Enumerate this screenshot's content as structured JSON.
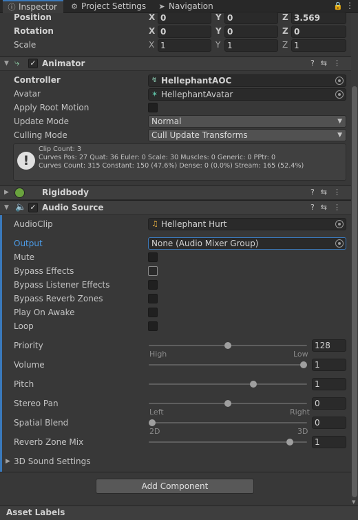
{
  "tabs": [
    {
      "label": "Inspector",
      "icon": "info-icon"
    },
    {
      "label": "Project Settings",
      "icon": "gear-icon"
    },
    {
      "label": "Navigation",
      "icon": "navigation-icon"
    }
  ],
  "transform": {
    "position": {
      "label": "Position",
      "x": "0",
      "y": "0",
      "z": "3.569"
    },
    "rotation": {
      "label": "Rotation",
      "x": "0",
      "y": "0",
      "z": "0"
    },
    "scale": {
      "label": "Scale",
      "x": "1",
      "y": "1",
      "z": "1"
    },
    "axes": {
      "x": "X",
      "y": "Y",
      "z": "Z"
    }
  },
  "animator": {
    "title": "Animator",
    "enabled": true,
    "controller": {
      "label": "Controller",
      "value": "HellephantAOC"
    },
    "avatar": {
      "label": "Avatar",
      "value": "HellephantAvatar"
    },
    "apply_root_motion": {
      "label": "Apply Root Motion",
      "checked": false
    },
    "update_mode": {
      "label": "Update Mode",
      "value": "Normal"
    },
    "culling_mode": {
      "label": "Culling Mode",
      "value": "Cull Update Transforms"
    },
    "info": {
      "line1": "Clip Count: 3",
      "line2": "Curves Pos: 27 Quat: 36 Euler: 0 Scale: 30 Muscles: 0 Generic: 0 PPtr: 0",
      "line3": "Curves Count: 315 Constant: 150 (47.6%) Dense: 0 (0.0%) Stream: 165 (52.4%)"
    }
  },
  "rigidbody": {
    "title": "Rigidbody"
  },
  "audio_source": {
    "title": "Audio Source",
    "enabled": true,
    "audioclip": {
      "label": "AudioClip",
      "value": "Hellephant Hurt"
    },
    "output": {
      "label": "Output",
      "value": "None (Audio Mixer Group)"
    },
    "toggles": [
      {
        "label": "Mute",
        "checked": false
      },
      {
        "label": "Bypass Effects",
        "checked": false
      },
      {
        "label": "Bypass Listener Effects",
        "checked": false
      },
      {
        "label": "Bypass Reverb Zones",
        "checked": false
      },
      {
        "label": "Play On Awake",
        "checked": false
      },
      {
        "label": "Loop",
        "checked": false
      }
    ],
    "priority": {
      "label": "Priority",
      "value": "128",
      "fraction": 0.5,
      "min_label": "High",
      "max_label": "Low"
    },
    "volume": {
      "label": "Volume",
      "value": "1",
      "fraction": 1.0
    },
    "pitch": {
      "label": "Pitch",
      "value": "1",
      "fraction": 0.667
    },
    "stereo_pan": {
      "label": "Stereo Pan",
      "value": "0",
      "fraction": 0.5,
      "min_label": "Left",
      "max_label": "Right"
    },
    "spatial_blend": {
      "label": "Spatial Blend",
      "value": "0",
      "fraction": 0.0,
      "min_label": "2D",
      "max_label": "3D"
    },
    "reverb_zone_mix": {
      "label": "Reverb Zone Mix",
      "value": "1",
      "fraction": 0.909
    },
    "sound_settings": {
      "label": "3D Sound Settings"
    }
  },
  "add_component": "Add Component",
  "asset_labels": "Asset Labels",
  "colors": {
    "accent": "#3a79bb",
    "panel": "#383838",
    "header": "#3e3e3e"
  }
}
